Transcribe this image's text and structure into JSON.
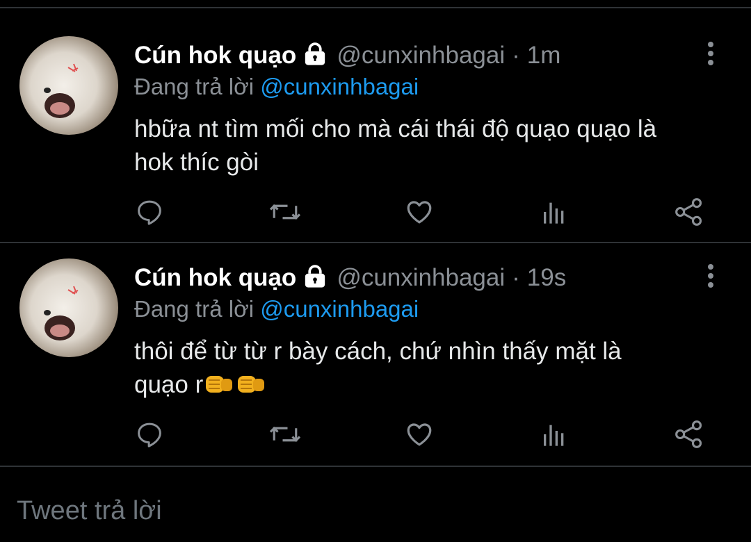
{
  "tweets": [
    {
      "display_name": "Cún hok quạo",
      "handle": "@cunxinhbagai",
      "separator": "·",
      "time": "1m",
      "replying_prefix": "Đang trả lời",
      "replying_to": "@cunxinhbagai",
      "text_lines": [
        "hbữa nt tìm mối cho mà cái thái độ quạo quạo là",
        "hok thíc gòi"
      ]
    },
    {
      "display_name": "Cún hok quạo",
      "handle": "@cunxinhbagai",
      "separator": "·",
      "time": "19s",
      "replying_prefix": "Đang trả lời",
      "replying_to": "@cunxinhbagai",
      "text_lines": [
        "thôi để từ từ r bày cách, chứ nhìn thấy mặt là",
        "quạo r"
      ],
      "trailing_emoji": [
        "oncoming-fist",
        "oncoming-fist"
      ]
    }
  ],
  "actions": [
    "reply-icon",
    "retweet-icon",
    "like-icon",
    "analytics-icon",
    "share-icon"
  ],
  "composer": {
    "placeholder": "Tweet trả lời"
  },
  "colors": {
    "background": "#000000",
    "divider": "#2f3336",
    "muted": "#8b9096",
    "link": "#1d9bf0",
    "text": "#e7e9ea"
  }
}
